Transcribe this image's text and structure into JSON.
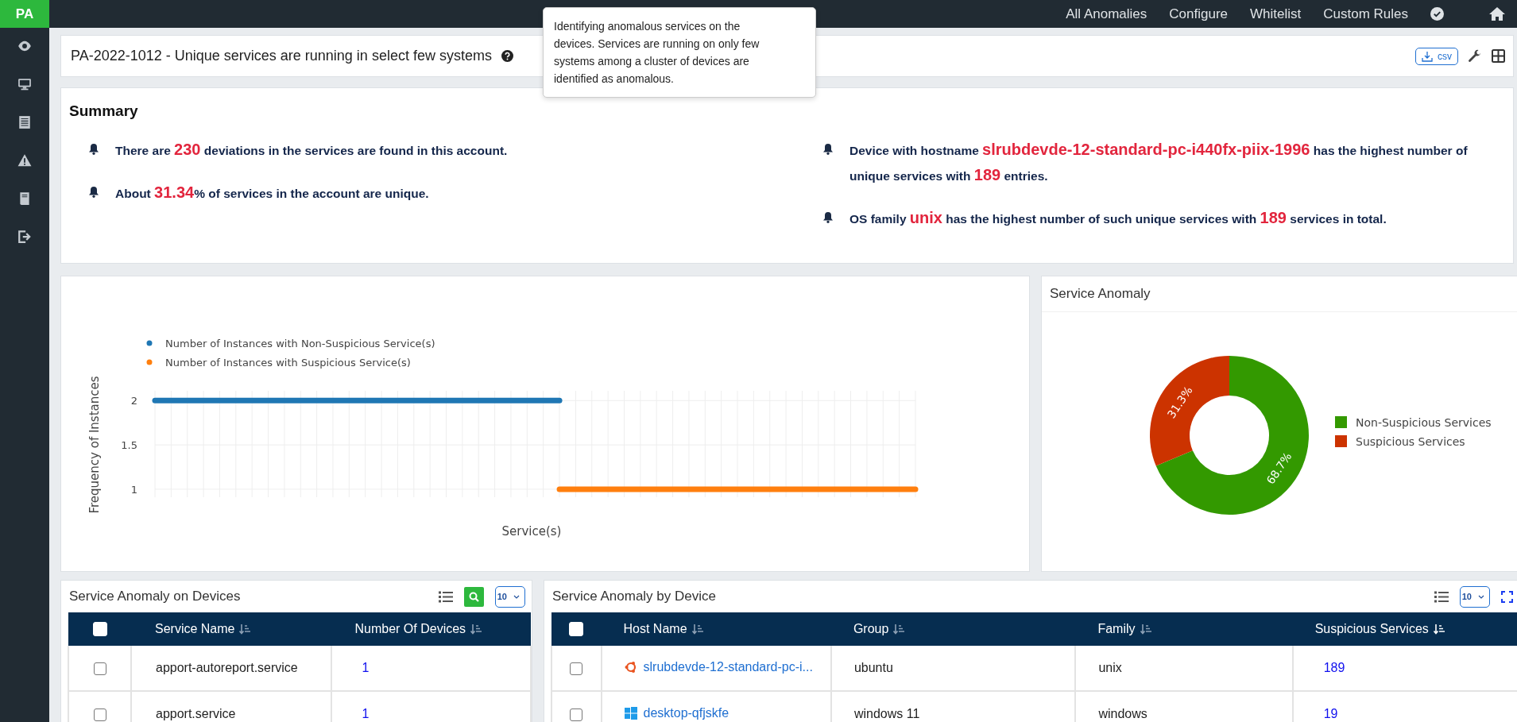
{
  "brand": "PA",
  "top_nav": {
    "links": [
      "All Anomalies",
      "Configure",
      "Whitelist",
      "Custom Rules"
    ]
  },
  "header": {
    "title": "PA-2022-1012 - Unique services are running in select few systems",
    "export_label": "csv"
  },
  "tooltip": {
    "text": "Identifying anomalous services on the devices. Services are running on only few systems among a cluster of devices are identified as anomalous."
  },
  "summary": {
    "title": "Summary",
    "left": [
      "There are **230** deviations in the services are found in this account.",
      "About **31.34**% of services in the account are unique."
    ],
    "right": [
      "Device with hostname **slrubdevde-12-standard-pc-i440fx-piix-1996** has the highest number of unique services with **189** entries.",
      "OS family **unix** has the highest number of such unique services with **189** services in total."
    ]
  },
  "instances_chart": {
    "chart_data": {
      "type": "line",
      "xlabel": "Service(s)",
      "ylabel": "Frequency of Instances",
      "ylim": [
        0.91,
        2.11
      ],
      "yticks": [
        1,
        {
          "value": 1.5,
          "label": "1.5"
        },
        2
      ],
      "legend": true,
      "grid": true,
      "series": [
        {
          "name": "Number of Instances with Non-Suspicious Service(s)",
          "color": "#1f77b4",
          "values": [
            2,
            2,
            2,
            2,
            2,
            2,
            2,
            2,
            2,
            2,
            2,
            2,
            2,
            2,
            2,
            2,
            2,
            2,
            2,
            2,
            2,
            2,
            2,
            2,
            2,
            2,
            null,
            null,
            null,
            null,
            null,
            null,
            null,
            null,
            null,
            null,
            null,
            null,
            null,
            null,
            null,
            null,
            null,
            null,
            null,
            null,
            null,
            null
          ]
        },
        {
          "name": "Number of Instances with Suspicious Service(s)",
          "color": "#ff7f0e",
          "values": [
            null,
            null,
            null,
            null,
            null,
            null,
            null,
            null,
            null,
            null,
            null,
            null,
            null,
            null,
            null,
            null,
            null,
            null,
            null,
            null,
            null,
            null,
            null,
            null,
            null,
            1,
            1,
            1,
            1,
            1,
            1,
            1,
            1,
            1,
            1,
            1,
            1,
            1,
            1,
            1,
            1,
            1,
            1,
            1,
            1,
            1,
            1,
            1
          ]
        }
      ]
    }
  },
  "service_anomaly": {
    "title": "Service Anomaly",
    "chart_data": {
      "type": "donut",
      "categories": [
        "Non-Suspicious Services",
        "Suspicious Services"
      ],
      "colors": [
        "#339900",
        "#cc3300"
      ],
      "value_labels": [
        "68.7%",
        "31.3%"
      ],
      "legend": true,
      "series": [
        {
          "values": [
            68.7,
            31.3
          ]
        }
      ]
    }
  },
  "devices_table": {
    "title": "Service Anomaly on Devices",
    "page_size": "10",
    "all_checked": false,
    "columns": [
      {
        "label": "Service Name",
        "sorted": false
      },
      {
        "label": "Number Of Devices",
        "sorted": false
      }
    ],
    "rows": [
      {
        "checked": false,
        "service_name": "apport-autoreport.service",
        "devices": "1"
      },
      {
        "checked": false,
        "service_name": "apport.service",
        "devices": "1"
      }
    ]
  },
  "by_device_table": {
    "title": "Service Anomaly by Device",
    "page_size": "10",
    "all_checked": false,
    "columns": [
      {
        "label": "Host Name",
        "sorted": false
      },
      {
        "label": "Group",
        "sorted": false
      },
      {
        "label": "Family",
        "sorted": false
      },
      {
        "label": "Suspicious Services",
        "sorted": true
      }
    ],
    "rows": [
      {
        "checked": false,
        "kind": "ubuntu",
        "host": "slrubdevde-12-standard-pc-i...",
        "group": "ubuntu",
        "family": "unix",
        "count": "189"
      },
      {
        "checked": false,
        "kind": "windows",
        "host": "desktop-qfjskfe",
        "group": "windows 11",
        "family": "windows",
        "count": "19"
      }
    ]
  }
}
